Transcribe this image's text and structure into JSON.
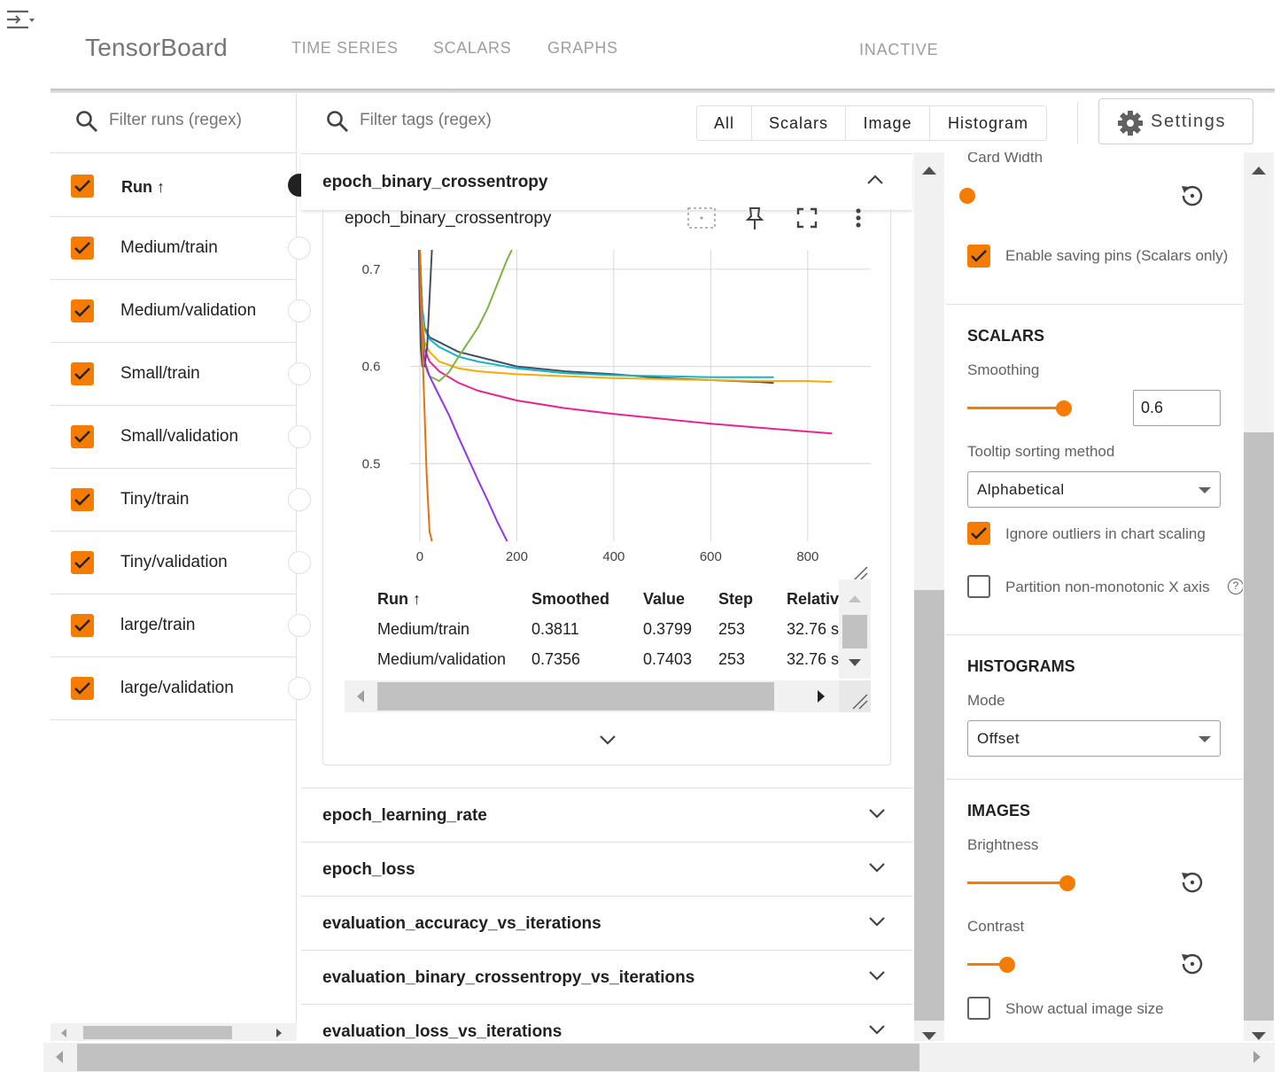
{
  "header": {
    "brand": "TensorBoard",
    "tabs": [
      "TIME SERIES",
      "SCALARS",
      "GRAPHS"
    ],
    "status": "INACTIVE"
  },
  "runs_panel": {
    "filter_placeholder": "Filter runs (regex)",
    "column_header": "Run ↑",
    "runs": [
      {
        "label": "Medium/train",
        "checked": true
      },
      {
        "label": "Medium/validation",
        "checked": true
      },
      {
        "label": "Small/train",
        "checked": true
      },
      {
        "label": "Small/validation",
        "checked": true
      },
      {
        "label": "Tiny/train",
        "checked": true
      },
      {
        "label": "Tiny/validation",
        "checked": true
      },
      {
        "label": "large/train",
        "checked": true
      },
      {
        "label": "large/validation",
        "checked": true
      }
    ]
  },
  "toolbar": {
    "filter_placeholder": "Filter tags (regex)",
    "type_filters": [
      "All",
      "Scalars",
      "Image",
      "Histogram"
    ],
    "settings_label": "Settings"
  },
  "card": {
    "group_title": "epoch_binary_crossentropy",
    "chart_title": "epoch_binary_crossentropy",
    "table": {
      "headers": [
        "Run ↑",
        "Smoothed",
        "Value",
        "Step",
        "Relativ"
      ],
      "rows": [
        [
          "Medium/train",
          "0.3811",
          "0.3799",
          "253",
          "32.76 s"
        ],
        [
          "Medium/validation",
          "0.7356",
          "0.7403",
          "253",
          "32.76 s"
        ]
      ]
    }
  },
  "chart_data": {
    "type": "line",
    "title": "epoch_binary_crossentropy",
    "xlabel": "",
    "ylabel": "",
    "xlim": [
      -20,
      930
    ],
    "ylim": [
      0.42,
      0.72
    ],
    "x_ticks": [
      0,
      200,
      400,
      600,
      800
    ],
    "y_ticks": [
      0.5,
      0.6,
      0.7
    ],
    "grid": true,
    "series": [
      {
        "color": "#425066",
        "x": [
          0,
          5,
          10,
          15,
          20,
          40,
          80,
          120,
          200,
          300,
          400,
          500,
          600,
          700,
          730
        ],
        "y": [
          0.72,
          0.66,
          0.64,
          0.635,
          0.63,
          0.625,
          0.615,
          0.61,
          0.6,
          0.595,
          0.592,
          0.588,
          0.586,
          0.584,
          0.583
        ]
      },
      {
        "color": "#12b5cb",
        "x": [
          0,
          5,
          10,
          20,
          40,
          80,
          120,
          200,
          300,
          400,
          500,
          600,
          700,
          730
        ],
        "y": [
          0.72,
          0.66,
          0.638,
          0.628,
          0.62,
          0.61,
          0.605,
          0.598,
          0.593,
          0.591,
          0.59,
          0.589,
          0.589,
          0.589
        ]
      },
      {
        "color": "#f9ab00",
        "x": [
          0,
          5,
          10,
          20,
          40,
          80,
          120,
          200,
          300,
          400,
          500,
          600,
          700,
          800,
          850
        ],
        "y": [
          0.72,
          0.65,
          0.625,
          0.615,
          0.605,
          0.598,
          0.595,
          0.592,
          0.59,
          0.588,
          0.587,
          0.586,
          0.585,
          0.585,
          0.584
        ]
      },
      {
        "color": "#e52592",
        "x": [
          0,
          5,
          10,
          20,
          40,
          80,
          120,
          200,
          300,
          400,
          500,
          600,
          700,
          800,
          850
        ],
        "y": [
          0.72,
          0.64,
          0.618,
          0.605,
          0.595,
          0.583,
          0.575,
          0.565,
          0.557,
          0.551,
          0.546,
          0.541,
          0.537,
          0.533,
          0.531
        ]
      },
      {
        "color": "#7cb342",
        "x": [
          0,
          5,
          10,
          15,
          20,
          40,
          60,
          80,
          100,
          120,
          140,
          160,
          180,
          190
        ],
        "y": [
          0.72,
          0.64,
          0.605,
          0.595,
          0.59,
          0.585,
          0.594,
          0.61,
          0.625,
          0.64,
          0.66,
          0.685,
          0.71,
          0.72
        ]
      },
      {
        "color": "#425066",
        "x": [
          -2,
          0,
          2,
          5,
          10,
          15,
          20,
          25
        ],
        "y": [
          0.72,
          0.66,
          0.62,
          0.6,
          0.6,
          0.62,
          0.67,
          0.72
        ]
      },
      {
        "color": "#9334e6",
        "x": [
          0,
          5,
          10,
          20,
          40,
          60,
          80,
          100,
          120,
          140,
          160,
          180
        ],
        "y": [
          0.72,
          0.62,
          0.605,
          0.59,
          0.57,
          0.55,
          0.527,
          0.505,
          0.483,
          0.462,
          0.44,
          0.42
        ]
      },
      {
        "color": "#e8710a",
        "x": [
          0,
          2,
          4,
          6,
          8,
          10,
          12,
          14,
          16,
          18,
          20,
          25
        ],
        "y": [
          0.72,
          0.67,
          0.64,
          0.61,
          0.58,
          0.55,
          0.52,
          0.49,
          0.47,
          0.45,
          0.43,
          0.42
        ]
      }
    ]
  },
  "groups": [
    "epoch_learning_rate",
    "epoch_loss",
    "evaluation_accuracy_vs_iterations",
    "evaluation_binary_crossentropy_vs_iterations",
    "evaluation_loss_vs_iterations"
  ],
  "settings": {
    "card_width_label": "Card Width",
    "enable_pins_label": "Enable saving pins (Scalars only)",
    "scalars_title": "SCALARS",
    "smoothing_label": "Smoothing",
    "smoothing_value": "0.6",
    "tooltip_label": "Tooltip sorting method",
    "tooltip_value": "Alphabetical",
    "ignore_outliers_label": "Ignore outliers in chart scaling",
    "partition_label": "Partition non-monotonic X axis",
    "histograms_title": "HISTOGRAMS",
    "mode_label": "Mode",
    "mode_value": "Offset",
    "images_title": "IMAGES",
    "brightness_label": "Brightness",
    "contrast_label": "Contrast",
    "actual_size_label": "Show actual image size"
  },
  "colors": {
    "accent": "#f57c00"
  }
}
